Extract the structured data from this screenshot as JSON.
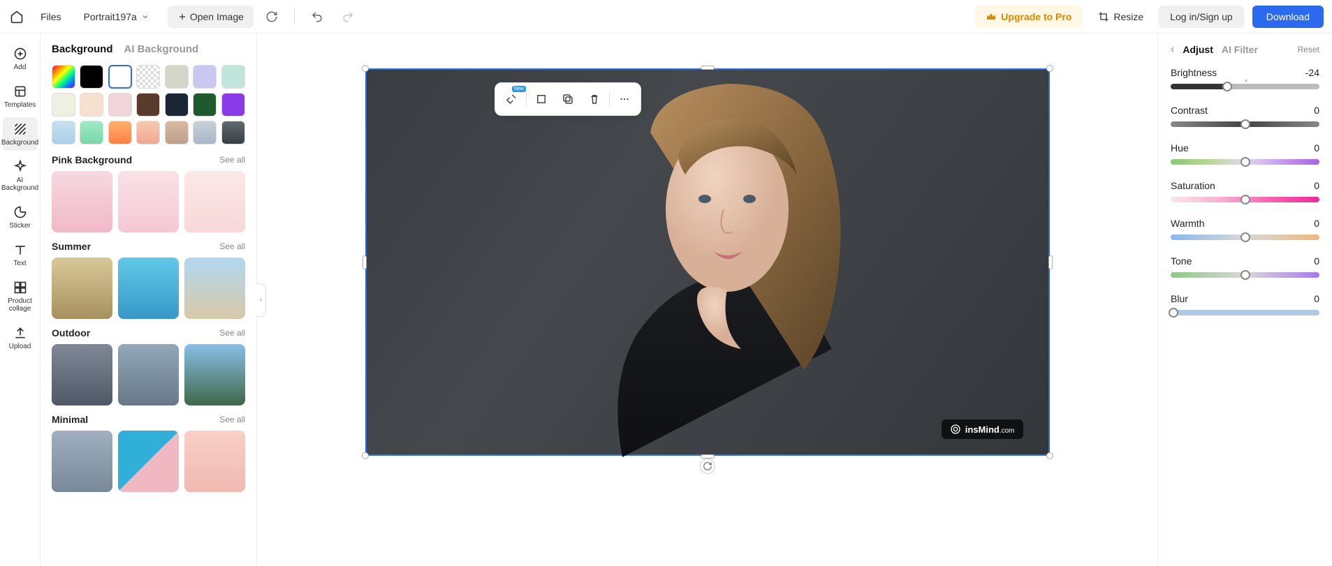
{
  "topbar": {
    "files": "Files",
    "filename": "Portrait197a",
    "open_image": "Open Image",
    "upgrade": "Upgrade to Pro",
    "resize": "Resize",
    "login": "Log in/Sign up",
    "download": "Download"
  },
  "nav": {
    "add": "Add",
    "templates": "Templates",
    "background": "Background",
    "ai_background": "AI Background",
    "sticker": "Sticker",
    "text": "Text",
    "product_collage": "Product collage",
    "upload": "Upload"
  },
  "bg_panel": {
    "tab_bg": "Background",
    "tab_ai": "AI Background",
    "see_all": "See all",
    "sections": {
      "pink": "Pink Background",
      "summer": "Summer",
      "outdoor": "Outdoor",
      "minimal": "Minimal"
    }
  },
  "floating_toolbar": {
    "badge": "New"
  },
  "watermark": {
    "brand": "insMind",
    "suffix": ".com"
  },
  "adjust": {
    "tab_adjust": "Adjust",
    "tab_filter": "AI Filter",
    "reset": "Reset",
    "brightness": {
      "label": "Brightness",
      "value": "-24"
    },
    "contrast": {
      "label": "Contrast",
      "value": "0"
    },
    "hue": {
      "label": "Hue",
      "value": "0"
    },
    "saturation": {
      "label": "Saturation",
      "value": "0"
    },
    "warmth": {
      "label": "Warmth",
      "value": "0"
    },
    "tone": {
      "label": "Tone",
      "value": "0"
    },
    "blur": {
      "label": "Blur",
      "value": "0"
    }
  },
  "swatches_row1": [
    "linear-gradient(135deg,#ff0080,#ff8000,#ffff00,#00ff80,#0080ff,#8000ff)",
    "#000000",
    "#ffffff",
    "repeating-conic-gradient(#ddd 0% 25%,#fff 0% 50%) 50%/8px 8px",
    "#d6d6c8",
    "#c8c8f0",
    "#c0e6dc"
  ],
  "swatches_row2": [
    "#f0f0e0",
    "#f8e0d0",
    "#f0d4d8",
    "#5a3a2a",
    "#1a2636",
    "#1e5a2e",
    "#8a3ae8"
  ],
  "swatches_row3": [
    "linear-gradient(#c8e0f0,#a8d0e8)",
    "linear-gradient(#a0e8c8,#78d8a8)",
    "linear-gradient(#ffb070,#ff8040)",
    "linear-gradient(#f8c8b0,#f0a890)",
    "linear-gradient(#d8b8a0,#c0a088)",
    "linear-gradient(#c8d0d8,#a8b8c8)",
    "linear-gradient(#606870,#383e44)"
  ],
  "thumbs": {
    "pink": [
      "linear-gradient(#f8d8e0,#f0b8c8)",
      "linear-gradient(#fae0e8,#f4c8d4)",
      "linear-gradient(#fce8e8,#f8d8d8)"
    ],
    "summer": [
      "linear-gradient(#d8c898,#a89060)",
      "linear-gradient(#60c8e8,#3898c8)",
      "linear-gradient(#b0d8f0,#d8c8a8)"
    ],
    "outdoor": [
      "linear-gradient(#808898,#505868)",
      "linear-gradient(#90a8b8,#687888)",
      "linear-gradient(#88c0e8,#406848)"
    ],
    "minimal": [
      "linear-gradient(#a0b0c0,#788898)",
      "linear-gradient(135deg,#30b0d8 50%,#f0b8c0 50%)",
      "linear-gradient(#f8d0c8,#f0b8b0)"
    ]
  }
}
